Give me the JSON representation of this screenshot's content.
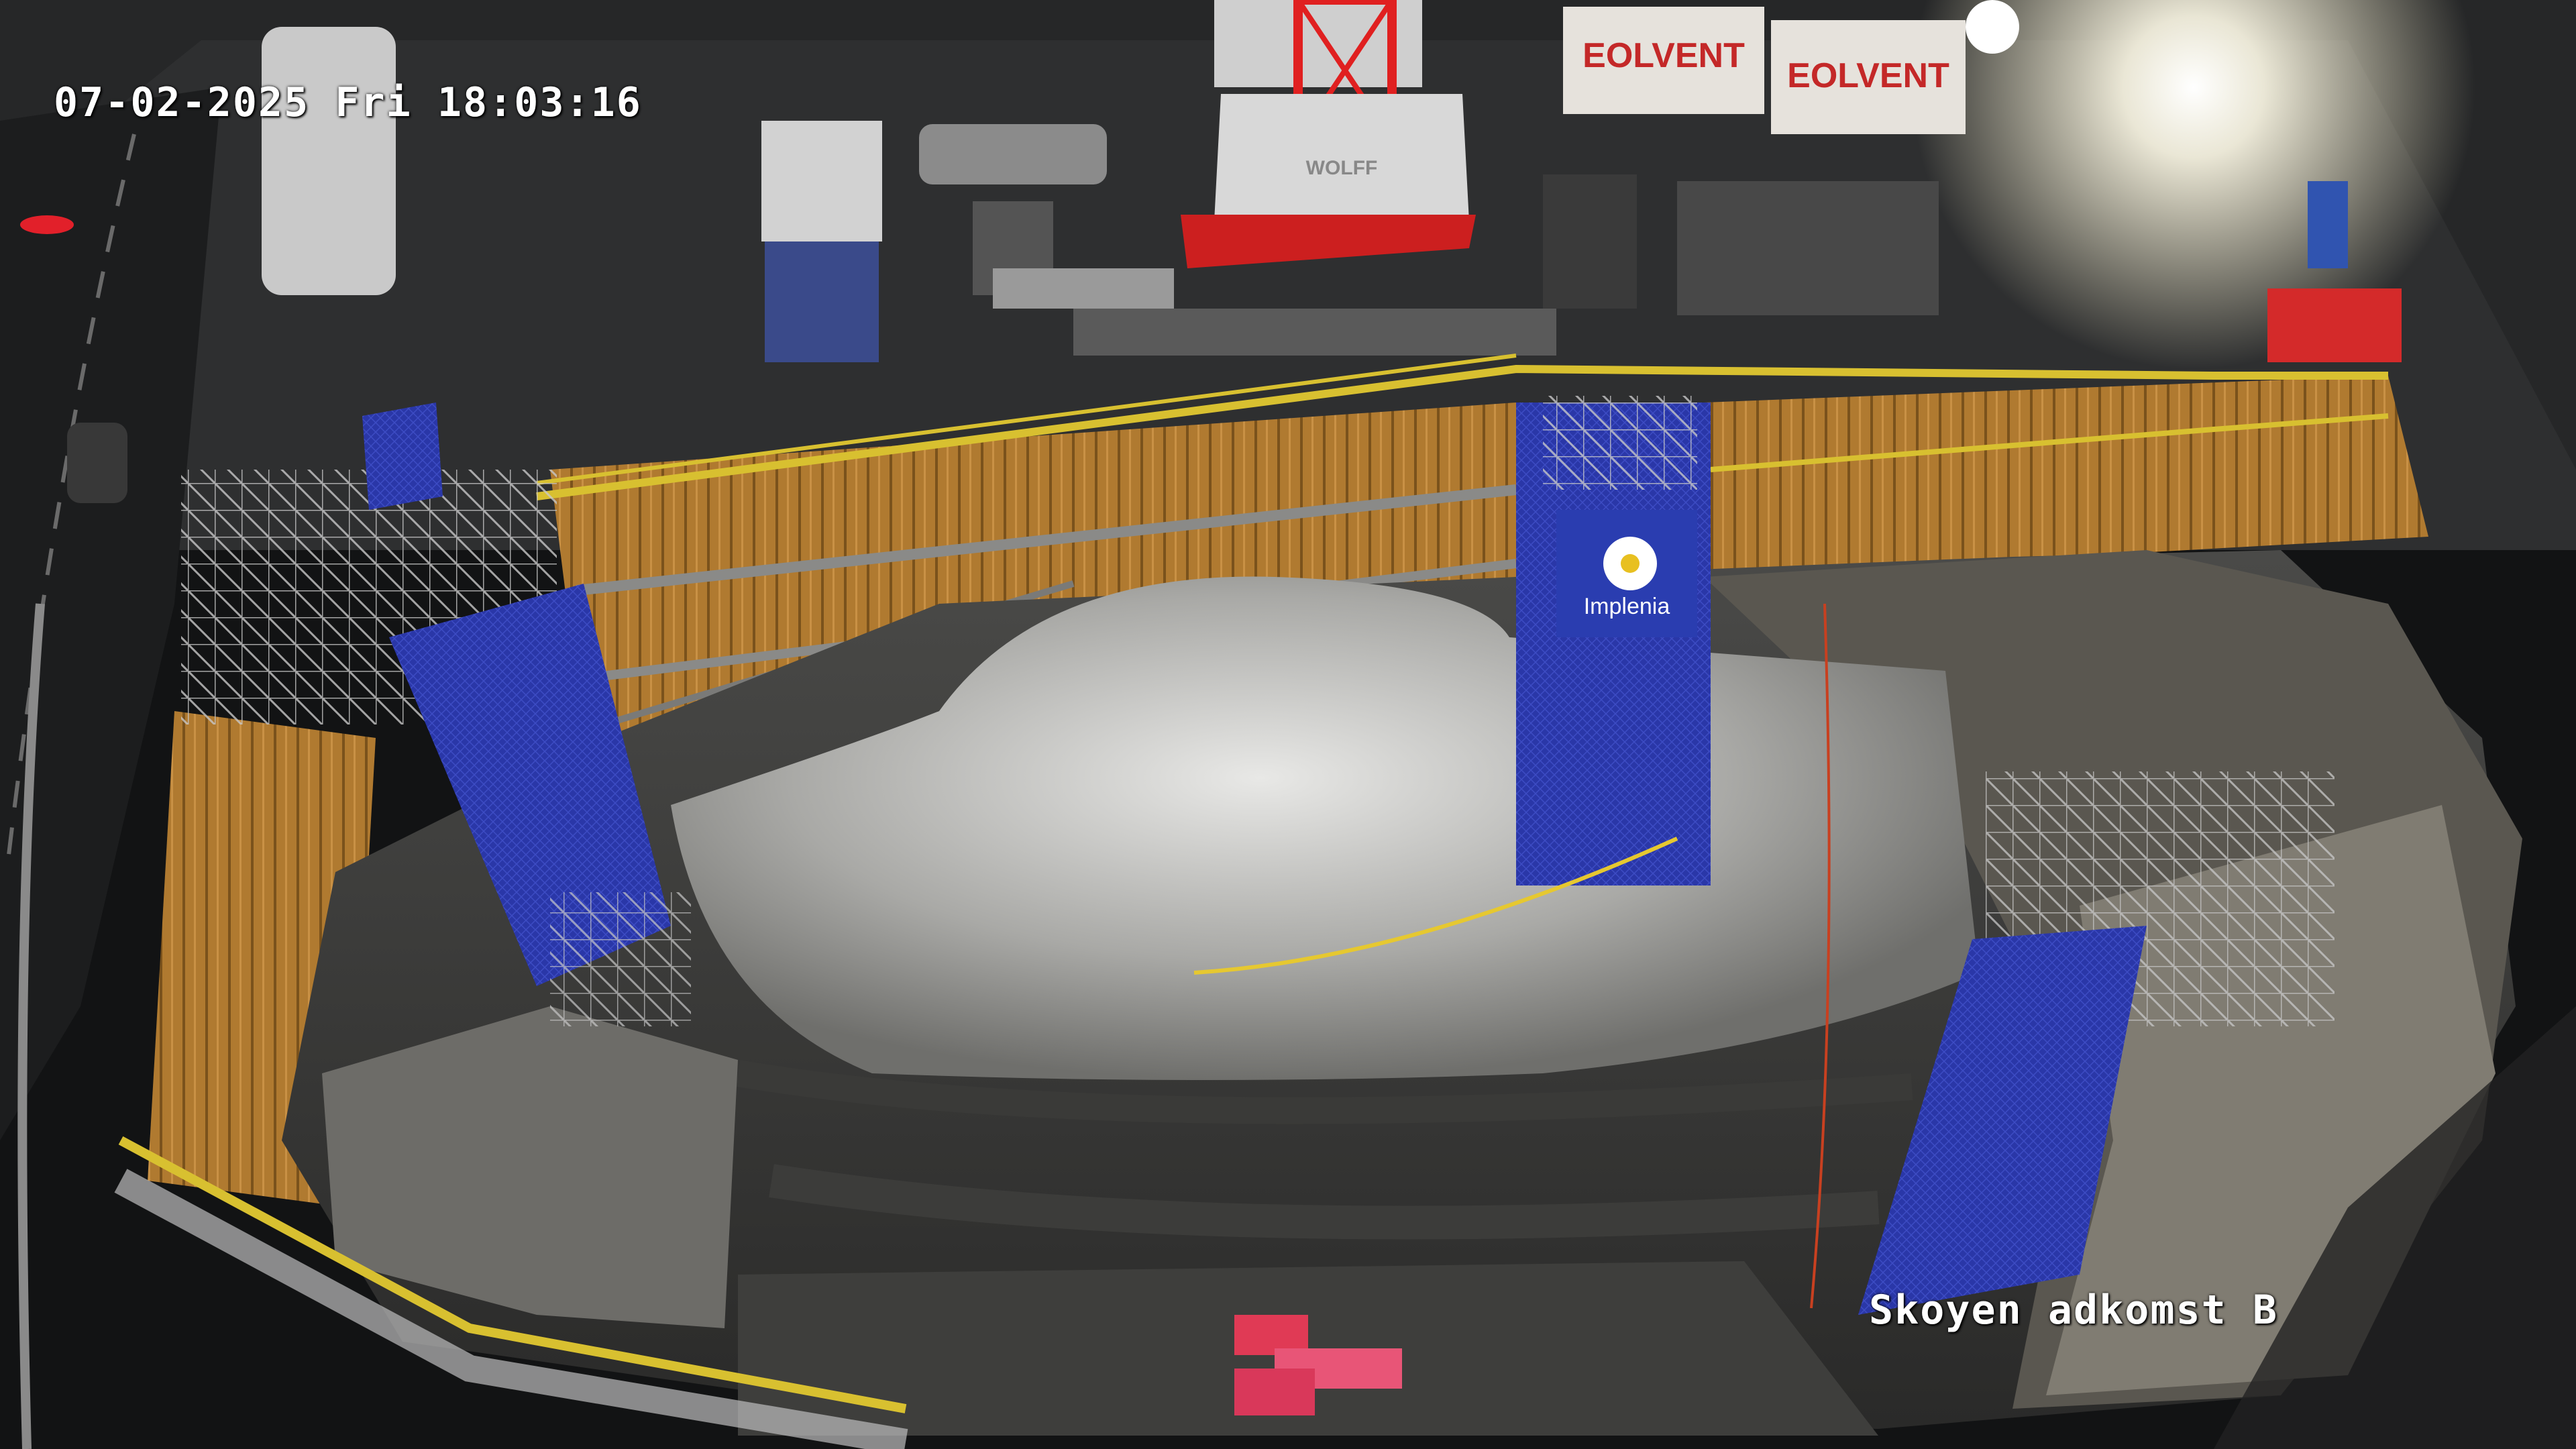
{
  "camera": {
    "timestamp": "07-02-2025 Fri 18:03:16",
    "location_label": "Skoyen adkomst B"
  },
  "signage": {
    "container_brand": "EOLVENT",
    "banner_brand": "Implenia",
    "block_text": "WOLFF"
  },
  "colors": {
    "night_sky": "#121314",
    "ground": "#2e2f30",
    "sheet_piles": "#b07a30",
    "scaffold_net": "#2a37a8",
    "railing": "#d8c030",
    "rock": "#b9b9b6",
    "crane": "#d42020",
    "floodlight": "#ffffff"
  }
}
